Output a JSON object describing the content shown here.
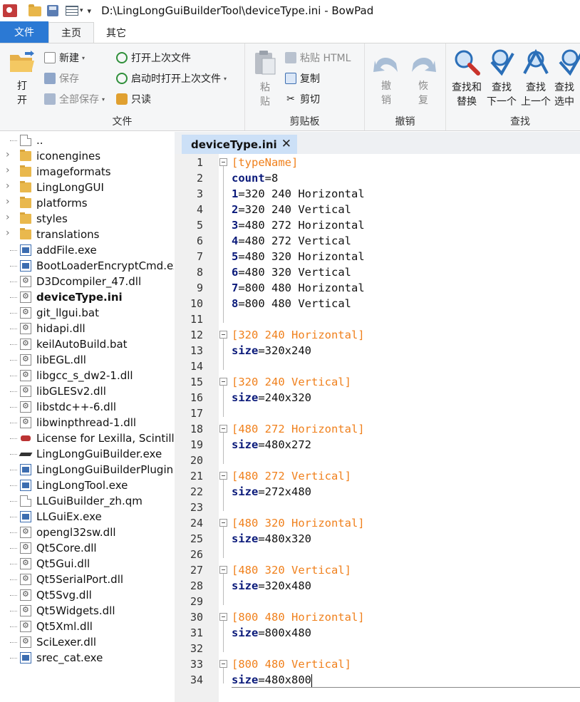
{
  "window": {
    "title": "D:\\LingLongGuiBuilderTool\\deviceType.ini - BowPad"
  },
  "quick_access": {
    "icons": [
      "app-icon",
      "open-folder-icon",
      "save-icon",
      "list-icon"
    ]
  },
  "ribbon_tabs": [
    {
      "label": "文件"
    },
    {
      "label": "主页"
    },
    {
      "label": "其它"
    }
  ],
  "ribbon": {
    "file_group": {
      "label": "文件",
      "open": "打\n开",
      "new": "新建",
      "save": "保存",
      "save_all": "全部保存",
      "reopen_last": "打开上次文件",
      "reopen_startup": "启动时打开上次文件",
      "readonly": "只读"
    },
    "clipboard_group": {
      "label": "剪贴板",
      "paste": "粘\n贴",
      "paste_html": "粘贴 HTML",
      "copy": "复制",
      "cut": "剪切"
    },
    "undo_group": {
      "label": "撤销",
      "undo": "撤\n销",
      "redo": "恢\n复"
    },
    "find_group": {
      "label": "查找",
      "find_replace": "查找和\n替换",
      "find_next": "查找\n下一个",
      "find_prev": "查找\n上一个",
      "find_sel": "查找\n选中"
    }
  },
  "tree": [
    {
      "name": "..",
      "type": "doc",
      "expandable": false
    },
    {
      "name": "iconengines",
      "type": "folder",
      "expandable": true
    },
    {
      "name": "imageformats",
      "type": "folder",
      "expandable": true
    },
    {
      "name": "LingLongGUI",
      "type": "folder",
      "expandable": true
    },
    {
      "name": "platforms",
      "type": "folder",
      "expandable": true
    },
    {
      "name": "styles",
      "type": "folder",
      "expandable": true
    },
    {
      "name": "translations",
      "type": "folder",
      "expandable": true
    },
    {
      "name": "addFile.exe",
      "type": "exe"
    },
    {
      "name": "BootLoaderEncryptCmd.ex",
      "type": "exe"
    },
    {
      "name": "D3Dcompiler_47.dll",
      "type": "gear"
    },
    {
      "name": "deviceType.ini",
      "type": "gear",
      "bold": true
    },
    {
      "name": "git_llgui.bat",
      "type": "gear"
    },
    {
      "name": "hidapi.dll",
      "type": "gear"
    },
    {
      "name": "keilAutoBuild.bat",
      "type": "gear"
    },
    {
      "name": "libEGL.dll",
      "type": "gear"
    },
    {
      "name": "libgcc_s_dw2-1.dll",
      "type": "gear"
    },
    {
      "name": "libGLESv2.dll",
      "type": "gear"
    },
    {
      "name": "libstdc++-6.dll",
      "type": "gear"
    },
    {
      "name": "libwinpthread-1.dll",
      "type": "gear"
    },
    {
      "name": "License for Lexilla, Scintilla",
      "type": "lic"
    },
    {
      "name": "LingLongGuiBuilder.exe",
      "type": "black"
    },
    {
      "name": "LingLongGuiBuilderPluginI",
      "type": "exe"
    },
    {
      "name": "LingLongTool.exe",
      "type": "exe"
    },
    {
      "name": "LLGuiBuilder_zh.qm",
      "type": "doc"
    },
    {
      "name": "LLGuiEx.exe",
      "type": "exe"
    },
    {
      "name": "opengl32sw.dll",
      "type": "gear"
    },
    {
      "name": "Qt5Core.dll",
      "type": "gear"
    },
    {
      "name": "Qt5Gui.dll",
      "type": "gear"
    },
    {
      "name": "Qt5SerialPort.dll",
      "type": "gear"
    },
    {
      "name": "Qt5Svg.dll",
      "type": "gear"
    },
    {
      "name": "Qt5Widgets.dll",
      "type": "gear"
    },
    {
      "name": "Qt5Xml.dll",
      "type": "gear"
    },
    {
      "name": "SciLexer.dll",
      "type": "gear"
    },
    {
      "name": "srec_cat.exe",
      "type": "exe"
    }
  ],
  "editor": {
    "tab_label": "deviceType.ini",
    "tab_close": "✕",
    "lines": [
      {
        "n": "1",
        "parts": [
          [
            "sec",
            "[typeName]"
          ]
        ],
        "fold": true
      },
      {
        "n": "2",
        "parts": [
          [
            "key",
            "count"
          ],
          [
            "val",
            "=8"
          ]
        ]
      },
      {
        "n": "3",
        "parts": [
          [
            "key",
            "1"
          ],
          [
            "val",
            "=320 240 Horizontal"
          ]
        ]
      },
      {
        "n": "4",
        "parts": [
          [
            "key",
            "2"
          ],
          [
            "val",
            "=320 240 Vertical"
          ]
        ]
      },
      {
        "n": "5",
        "parts": [
          [
            "key",
            "3"
          ],
          [
            "val",
            "=480 272 Horizontal"
          ]
        ]
      },
      {
        "n": "6",
        "parts": [
          [
            "key",
            "4"
          ],
          [
            "val",
            "=480 272 Vertical"
          ]
        ]
      },
      {
        "n": "7",
        "parts": [
          [
            "key",
            "5"
          ],
          [
            "val",
            "=480 320 Horizontal"
          ]
        ]
      },
      {
        "n": "8",
        "parts": [
          [
            "key",
            "6"
          ],
          [
            "val",
            "=480 320 Vertical"
          ]
        ]
      },
      {
        "n": "9",
        "parts": [
          [
            "key",
            "7"
          ],
          [
            "val",
            "=800 480 Horizontal"
          ]
        ]
      },
      {
        "n": "10",
        "parts": [
          [
            "key",
            "8"
          ],
          [
            "val",
            "=800 480 Vertical"
          ]
        ]
      },
      {
        "n": "11",
        "parts": []
      },
      {
        "n": "12",
        "parts": [
          [
            "sec",
            "[320 240 Horizontal]"
          ]
        ],
        "fold": true
      },
      {
        "n": "13",
        "parts": [
          [
            "key",
            "size"
          ],
          [
            "val",
            "=320x240"
          ]
        ]
      },
      {
        "n": "14",
        "parts": []
      },
      {
        "n": "15",
        "parts": [
          [
            "sec",
            "[320 240 Vertical]"
          ]
        ],
        "fold": true
      },
      {
        "n": "16",
        "parts": [
          [
            "key",
            "size"
          ],
          [
            "val",
            "=240x320"
          ]
        ]
      },
      {
        "n": "17",
        "parts": []
      },
      {
        "n": "18",
        "parts": [
          [
            "sec",
            "[480 272 Horizontal]"
          ]
        ],
        "fold": true
      },
      {
        "n": "19",
        "parts": [
          [
            "key",
            "size"
          ],
          [
            "val",
            "=480x272"
          ]
        ]
      },
      {
        "n": "20",
        "parts": []
      },
      {
        "n": "21",
        "parts": [
          [
            "sec",
            "[480 272 Vertical]"
          ]
        ],
        "fold": true
      },
      {
        "n": "22",
        "parts": [
          [
            "key",
            "size"
          ],
          [
            "val",
            "=272x480"
          ]
        ]
      },
      {
        "n": "23",
        "parts": []
      },
      {
        "n": "24",
        "parts": [
          [
            "sec",
            "[480 320 Horizontal]"
          ]
        ],
        "fold": true
      },
      {
        "n": "25",
        "parts": [
          [
            "key",
            "size"
          ],
          [
            "val",
            "=480x320"
          ]
        ]
      },
      {
        "n": "26",
        "parts": []
      },
      {
        "n": "27",
        "parts": [
          [
            "sec",
            "[480 320 Vertical]"
          ]
        ],
        "fold": true
      },
      {
        "n": "28",
        "parts": [
          [
            "key",
            "size"
          ],
          [
            "val",
            "=320x480"
          ]
        ]
      },
      {
        "n": "29",
        "parts": []
      },
      {
        "n": "30",
        "parts": [
          [
            "sec",
            "[800 480 Horizontal]"
          ]
        ],
        "fold": true
      },
      {
        "n": "31",
        "parts": [
          [
            "key",
            "size"
          ],
          [
            "val",
            "=800x480"
          ]
        ]
      },
      {
        "n": "32",
        "parts": []
      },
      {
        "n": "33",
        "parts": [
          [
            "sec",
            "[800 480 Vertical]"
          ]
        ],
        "fold": true
      },
      {
        "n": "34",
        "parts": [
          [
            "key",
            "size"
          ],
          [
            "val",
            "=480x800"
          ]
        ],
        "current": true
      }
    ]
  },
  "colors": {
    "accent": "#2b79d4",
    "section": "#f0801c",
    "key": "#0a1a7a",
    "tab_active": "#cce0f7"
  }
}
